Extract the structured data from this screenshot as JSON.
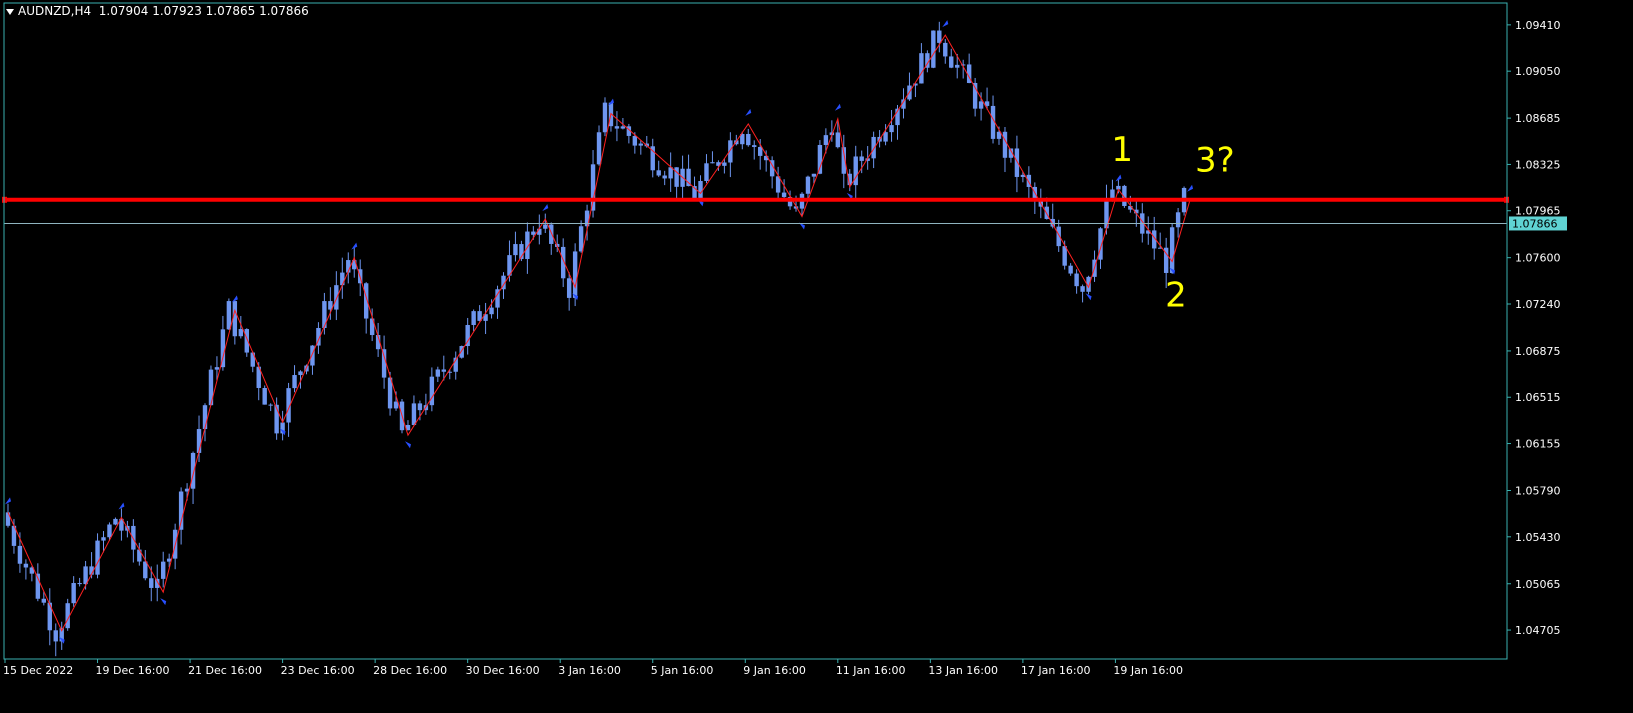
{
  "header": {
    "symbol": "AUDNZD,H4",
    "quote": "1.07904 1.07923 1.07865 1.07866"
  },
  "colors": {
    "background": "#000000",
    "frame": "#3ab1b1",
    "axis_text": "#ffffff",
    "candle": "#6e96f0",
    "zigzag": "#ff2020",
    "level_line": "#ff0000",
    "price_line": "#8fb4bf",
    "price_label_bg": "#5fd3d3",
    "annotation": "#ffff00",
    "fractal": "#2850ff"
  },
  "chart_data": {
    "type": "candlestick",
    "symbol": "AUDNZD",
    "timeframe": "H4",
    "ohlc_header": {
      "open": 1.07904,
      "high": 1.07923,
      "low": 1.07865,
      "close": 1.07866
    },
    "current_price_label": "1.07866",
    "y_ticks": [
      "1.09410",
      "1.09050",
      "1.08685",
      "1.08325",
      "1.07965",
      "1.07600",
      "1.07240",
      "1.06875",
      "1.06515",
      "1.06155",
      "1.05790",
      "1.05430",
      "1.05065",
      "1.04705"
    ],
    "x_ticks": [
      "15 Dec 2022",
      "19 Dec 16:00",
      "21 Dec 16:00",
      "23 Dec 16:00",
      "28 Dec 16:00",
      "30 Dec 16:00",
      "3 Jan 16:00",
      "5 Jan 16:00",
      "9 Jan 16:00",
      "11 Jan 16:00",
      "13 Jan 16:00",
      "17 Jan 16:00",
      "19 Jan 16:00"
    ],
    "ylim": [
      1.0448,
      1.0958
    ],
    "horizontal_level": 1.0805,
    "zigzag": [
      [
        0,
        1.0562
      ],
      [
        9,
        1.047
      ],
      [
        19,
        1.0558
      ],
      [
        26,
        1.05
      ],
      [
        38,
        1.0719
      ],
      [
        46,
        1.0632
      ],
      [
        58,
        1.076
      ],
      [
        67,
        1.0622
      ],
      [
        90,
        1.079
      ],
      [
        95,
        1.0737
      ],
      [
        101,
        1.0872
      ],
      [
        116,
        1.081
      ],
      [
        124,
        1.0864
      ],
      [
        133,
        1.0792
      ],
      [
        139,
        1.0868
      ],
      [
        141,
        1.0815
      ],
      [
        157,
        1.0933
      ],
      [
        181,
        1.0737
      ],
      [
        186,
        1.0813
      ],
      [
        195,
        1.0757
      ],
      [
        198,
        1.0805
      ]
    ],
    "annotations": [
      {
        "text": "1",
        "x": 186,
        "price": 1.0835
      },
      {
        "text": "2",
        "x": 195,
        "price": 1.0722
      },
      {
        "text": "3?",
        "x": 200,
        "price": 1.0827
      }
    ]
  }
}
